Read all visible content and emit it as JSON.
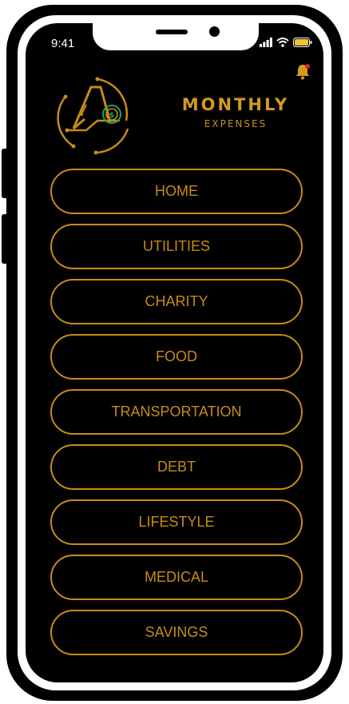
{
  "status_bar": {
    "time": "9:41"
  },
  "header": {
    "logo_icon": "dollar-coin-circuit-logo",
    "title": "MONTHLY",
    "subtitle": "EXPENSES",
    "notification_icon": "bell-icon"
  },
  "menu": {
    "items": [
      {
        "label": "HOME"
      },
      {
        "label": "UTILITIES"
      },
      {
        "label": "CHARITY"
      },
      {
        "label": "FOOD"
      },
      {
        "label": "TRANSPORTATION"
      },
      {
        "label": "DEBT"
      },
      {
        "label": "LIFESTYLE"
      },
      {
        "label": "MEDICAL"
      },
      {
        "label": "SAVINGS"
      }
    ]
  },
  "colors": {
    "accent": "#c68b17",
    "background": "#000000",
    "notification_dot": "#e02424",
    "coin_green": "#1fa35c"
  }
}
